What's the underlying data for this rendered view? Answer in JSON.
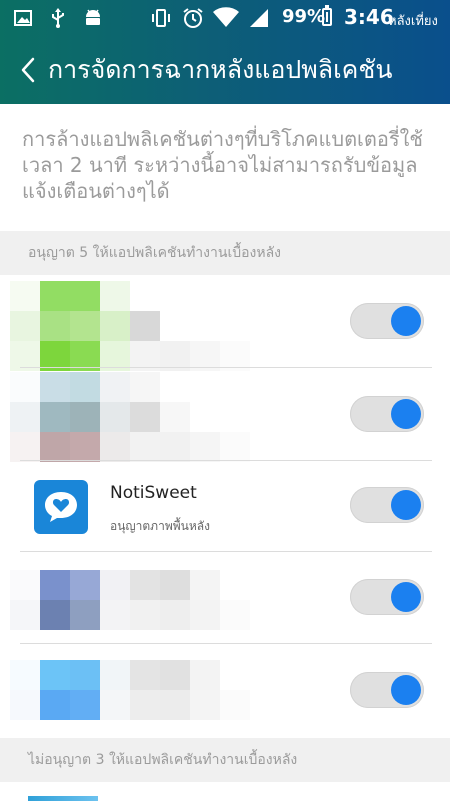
{
  "status": {
    "battery": "99%",
    "time": "3:46",
    "ampm": "หลังเที่ยง"
  },
  "header": {
    "title": "การจัดการฉากหลังแอปพลิเคชัน"
  },
  "description": "การล้างแอปพลิเคชันต่างๆที่บริโภคแบตเตอรี่ใช้เวลา 2 นาที ระหว่างนี้อาจไม่สามารถรับข้อมูลแจ้งเตือนต่างๆได้",
  "sections": {
    "allowed": "อนุญาต 5 ให้แอปพลิเคชันทำงานเบื้องหลัง",
    "denied": "ไม่อนุญาต 3 ให้แอปพลิเคชันทำงานเบื้องหลัง"
  },
  "apps": [
    {
      "name": "",
      "enabled": true
    },
    {
      "name": "",
      "enabled": true
    },
    {
      "name": "NotiSweet",
      "subtitle": "อนุญาตภาพพื้นหลัง",
      "enabled": true
    },
    {
      "name": "",
      "enabled": true
    },
    {
      "name": "",
      "enabled": true
    }
  ],
  "colors": {
    "toggle_on": "#1b80f0",
    "header_gradient_start": "#0b6f63",
    "header_gradient_end": "#0a4f8c"
  }
}
